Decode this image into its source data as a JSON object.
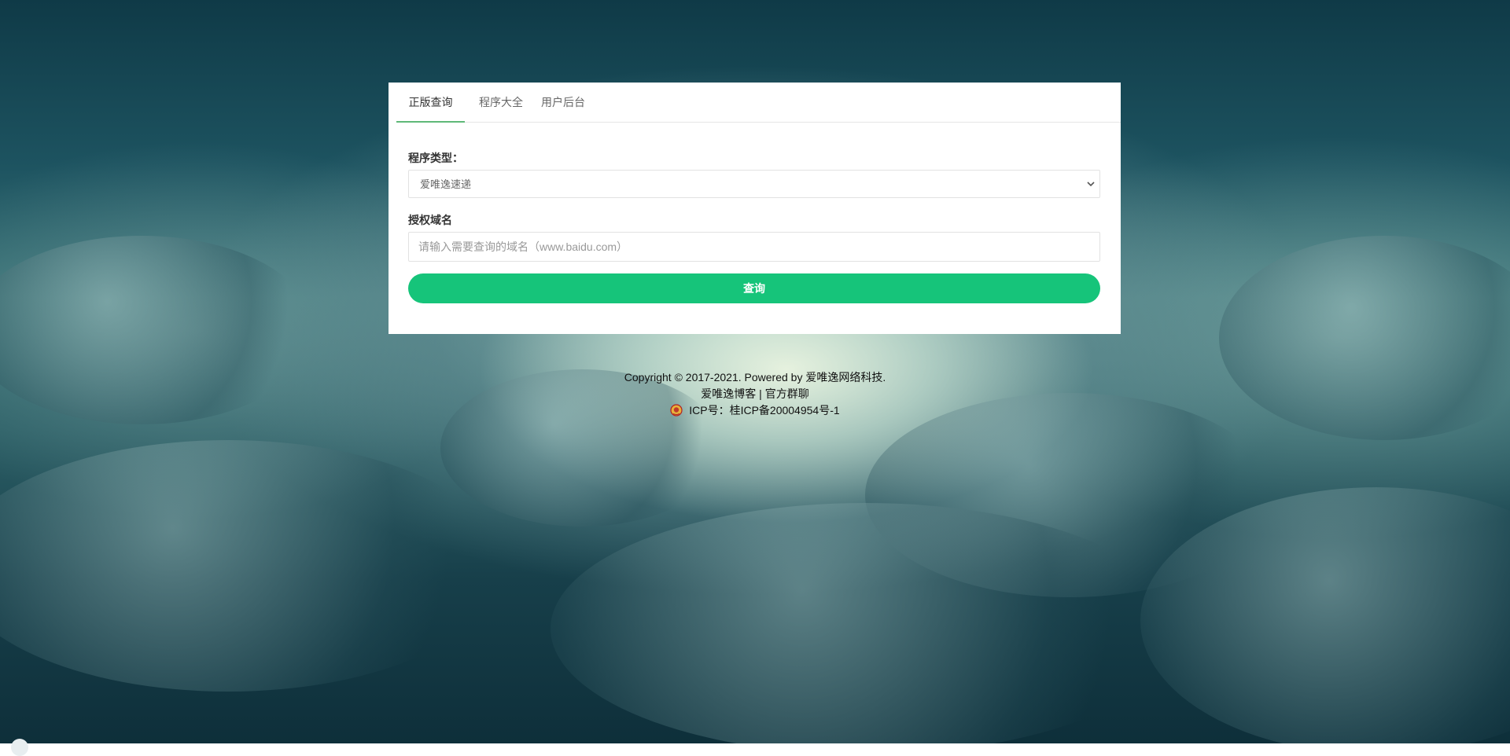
{
  "tabs": [
    {
      "label": "正版查询",
      "active": true
    },
    {
      "label": "程序大全",
      "active": false
    },
    {
      "label": "用户后台",
      "active": false
    }
  ],
  "form": {
    "program_type_label": "程序类型：",
    "program_type_value": "爱唯逸速递",
    "domain_label": "授权域名",
    "domain_placeholder": "请输入需要查询的域名（www.baidu.com）",
    "domain_value": "",
    "submit_label": "查询"
  },
  "footer": {
    "copyright": "Copyright © 2017-2021. Powered by 爱唯逸网络科技.",
    "blog_link": "爱唯逸博客",
    "separator": "|",
    "group_link": "官方群聊",
    "icp": "ICP号：桂ICP备20004954号-1"
  },
  "colors": {
    "accent": "#16c47a",
    "tab_indicator": "#5fb878"
  },
  "icons": {
    "select_arrow": "chevron-down-icon",
    "police_badge": "police-badge-icon"
  }
}
